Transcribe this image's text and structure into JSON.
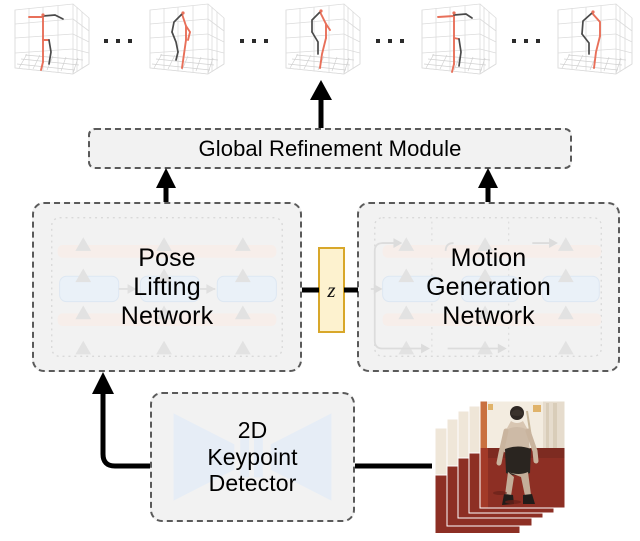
{
  "figure": {
    "title": "3D human pose and motion estimation pipeline",
    "background_color": "#ffffff"
  },
  "output_sequence": {
    "name": "3d-pose-sequence",
    "plot_count": 5,
    "separator_glyph": "...",
    "separator_count": 4,
    "skeleton_color": "#e8705a",
    "skeleton_secondary_color": "#3a3a3a",
    "box_grid_color": "#d8d8d8",
    "plots": [
      {
        "id": "pose-plot-1",
        "caption": "3d-pose-frame-1"
      },
      {
        "id": "pose-plot-2",
        "caption": "3d-pose-frame-2"
      },
      {
        "id": "pose-plot-3",
        "caption": "3d-pose-frame-3"
      },
      {
        "id": "pose-plot-4",
        "caption": "3d-pose-frame-4"
      },
      {
        "id": "pose-plot-5",
        "caption": "3d-pose-frame-5"
      }
    ]
  },
  "modules": {
    "global_refinement": {
      "label": "Global Refinement Module",
      "border_color": "#5a5a5a",
      "fill_color": "#f2f2f2",
      "border_style": "dashed"
    },
    "pose_lifting": {
      "label": "Pose\nLifting\nNetwork",
      "border_color": "#5a5a5a",
      "fill_color": "#f2f2f2",
      "border_style": "dashed"
    },
    "motion_generation": {
      "label": "Motion\nGeneration\nNetwork",
      "border_color": "#5a5a5a",
      "fill_color": "#f2f2f2",
      "border_style": "dashed"
    },
    "keypoint_detector": {
      "label": "2D\nKeypoint\nDetector",
      "border_color": "#8a8a8a",
      "fill_color": "#f2f2f2",
      "border_style": "dashed",
      "glyph_color": "#e4ecf5"
    },
    "latent": {
      "label": "z",
      "fill_color": "#fdf2cf",
      "border_color": "#d8a72a"
    }
  },
  "input": {
    "name": "video-frame-stack",
    "frame_count": 5,
    "description": "stacked video frames of a person standing",
    "floor_color": "#8d2f24",
    "wall_color": "#efe6d8",
    "subject_shorts_color": "#2a2520"
  },
  "connectors": [
    {
      "name": "keypoint-detector-to-pose-lifting",
      "style": "elbow-arrow",
      "color": "#000000"
    },
    {
      "name": "video-stack-to-keypoint-detector",
      "style": "straight-line",
      "color": "#000000"
    },
    {
      "name": "pose-lifting-to-latent-z",
      "style": "straight-line",
      "color": "#000000"
    },
    {
      "name": "latent-z-to-motion-generation",
      "style": "straight-line",
      "color": "#000000"
    },
    {
      "name": "pose-lifting-to-global-refinement",
      "style": "arrow-up",
      "color": "#000000"
    },
    {
      "name": "motion-generation-to-global-refinement",
      "style": "arrow-up",
      "color": "#000000"
    },
    {
      "name": "global-refinement-to-output-sequence",
      "style": "arrow-up",
      "color": "#000000"
    }
  ]
}
